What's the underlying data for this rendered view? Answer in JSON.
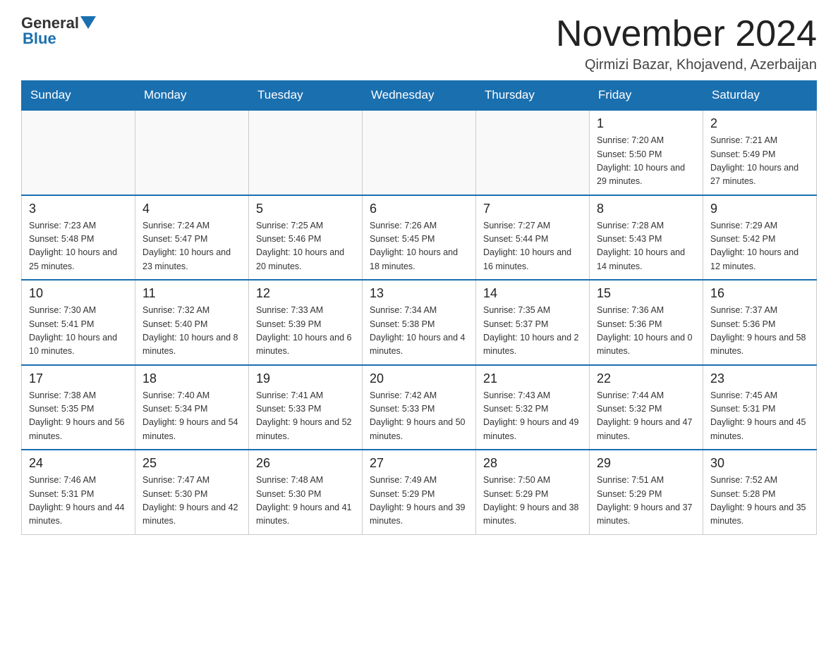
{
  "header": {
    "logo_general": "General",
    "logo_blue": "Blue",
    "month_title": "November 2024",
    "location": "Qirmizi Bazar, Khojavend, Azerbaijan"
  },
  "weekdays": [
    "Sunday",
    "Monday",
    "Tuesday",
    "Wednesday",
    "Thursday",
    "Friday",
    "Saturday"
  ],
  "weeks": [
    [
      {
        "day": "",
        "info": ""
      },
      {
        "day": "",
        "info": ""
      },
      {
        "day": "",
        "info": ""
      },
      {
        "day": "",
        "info": ""
      },
      {
        "day": "",
        "info": ""
      },
      {
        "day": "1",
        "info": "Sunrise: 7:20 AM\nSunset: 5:50 PM\nDaylight: 10 hours and 29 minutes."
      },
      {
        "day": "2",
        "info": "Sunrise: 7:21 AM\nSunset: 5:49 PM\nDaylight: 10 hours and 27 minutes."
      }
    ],
    [
      {
        "day": "3",
        "info": "Sunrise: 7:23 AM\nSunset: 5:48 PM\nDaylight: 10 hours and 25 minutes."
      },
      {
        "day": "4",
        "info": "Sunrise: 7:24 AM\nSunset: 5:47 PM\nDaylight: 10 hours and 23 minutes."
      },
      {
        "day": "5",
        "info": "Sunrise: 7:25 AM\nSunset: 5:46 PM\nDaylight: 10 hours and 20 minutes."
      },
      {
        "day": "6",
        "info": "Sunrise: 7:26 AM\nSunset: 5:45 PM\nDaylight: 10 hours and 18 minutes."
      },
      {
        "day": "7",
        "info": "Sunrise: 7:27 AM\nSunset: 5:44 PM\nDaylight: 10 hours and 16 minutes."
      },
      {
        "day": "8",
        "info": "Sunrise: 7:28 AM\nSunset: 5:43 PM\nDaylight: 10 hours and 14 minutes."
      },
      {
        "day": "9",
        "info": "Sunrise: 7:29 AM\nSunset: 5:42 PM\nDaylight: 10 hours and 12 minutes."
      }
    ],
    [
      {
        "day": "10",
        "info": "Sunrise: 7:30 AM\nSunset: 5:41 PM\nDaylight: 10 hours and 10 minutes."
      },
      {
        "day": "11",
        "info": "Sunrise: 7:32 AM\nSunset: 5:40 PM\nDaylight: 10 hours and 8 minutes."
      },
      {
        "day": "12",
        "info": "Sunrise: 7:33 AM\nSunset: 5:39 PM\nDaylight: 10 hours and 6 minutes."
      },
      {
        "day": "13",
        "info": "Sunrise: 7:34 AM\nSunset: 5:38 PM\nDaylight: 10 hours and 4 minutes."
      },
      {
        "day": "14",
        "info": "Sunrise: 7:35 AM\nSunset: 5:37 PM\nDaylight: 10 hours and 2 minutes."
      },
      {
        "day": "15",
        "info": "Sunrise: 7:36 AM\nSunset: 5:36 PM\nDaylight: 10 hours and 0 minutes."
      },
      {
        "day": "16",
        "info": "Sunrise: 7:37 AM\nSunset: 5:36 PM\nDaylight: 9 hours and 58 minutes."
      }
    ],
    [
      {
        "day": "17",
        "info": "Sunrise: 7:38 AM\nSunset: 5:35 PM\nDaylight: 9 hours and 56 minutes."
      },
      {
        "day": "18",
        "info": "Sunrise: 7:40 AM\nSunset: 5:34 PM\nDaylight: 9 hours and 54 minutes."
      },
      {
        "day": "19",
        "info": "Sunrise: 7:41 AM\nSunset: 5:33 PM\nDaylight: 9 hours and 52 minutes."
      },
      {
        "day": "20",
        "info": "Sunrise: 7:42 AM\nSunset: 5:33 PM\nDaylight: 9 hours and 50 minutes."
      },
      {
        "day": "21",
        "info": "Sunrise: 7:43 AM\nSunset: 5:32 PM\nDaylight: 9 hours and 49 minutes."
      },
      {
        "day": "22",
        "info": "Sunrise: 7:44 AM\nSunset: 5:32 PM\nDaylight: 9 hours and 47 minutes."
      },
      {
        "day": "23",
        "info": "Sunrise: 7:45 AM\nSunset: 5:31 PM\nDaylight: 9 hours and 45 minutes."
      }
    ],
    [
      {
        "day": "24",
        "info": "Sunrise: 7:46 AM\nSunset: 5:31 PM\nDaylight: 9 hours and 44 minutes."
      },
      {
        "day": "25",
        "info": "Sunrise: 7:47 AM\nSunset: 5:30 PM\nDaylight: 9 hours and 42 minutes."
      },
      {
        "day": "26",
        "info": "Sunrise: 7:48 AM\nSunset: 5:30 PM\nDaylight: 9 hours and 41 minutes."
      },
      {
        "day": "27",
        "info": "Sunrise: 7:49 AM\nSunset: 5:29 PM\nDaylight: 9 hours and 39 minutes."
      },
      {
        "day": "28",
        "info": "Sunrise: 7:50 AM\nSunset: 5:29 PM\nDaylight: 9 hours and 38 minutes."
      },
      {
        "day": "29",
        "info": "Sunrise: 7:51 AM\nSunset: 5:29 PM\nDaylight: 9 hours and 37 minutes."
      },
      {
        "day": "30",
        "info": "Sunrise: 7:52 AM\nSunset: 5:28 PM\nDaylight: 9 hours and 35 minutes."
      }
    ]
  ]
}
